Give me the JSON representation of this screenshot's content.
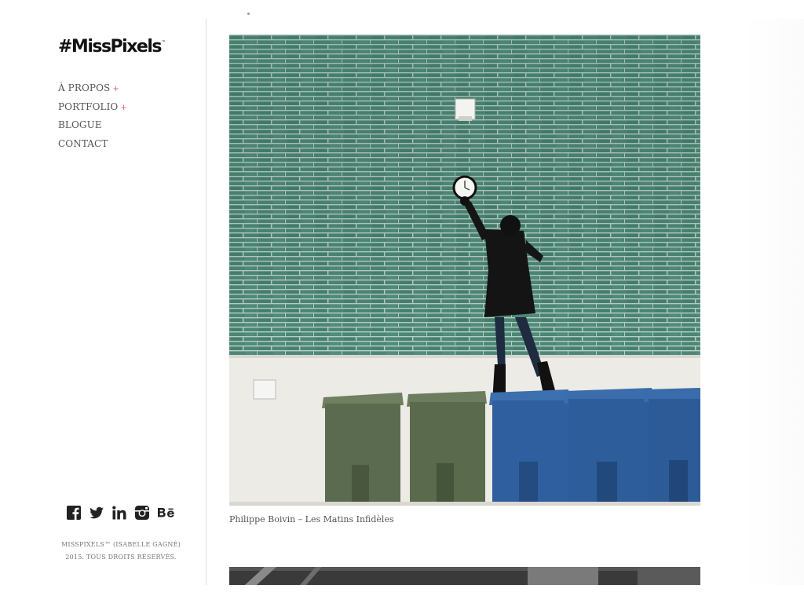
{
  "brand": {
    "logo_text": "#MissPixels",
    "logo_mark": "™"
  },
  "nav": {
    "items": [
      {
        "label": "À PROPOS",
        "suffix": "+"
      },
      {
        "label": "PORTFOLIO",
        "suffix": "+"
      },
      {
        "label": "BLOGUE",
        "suffix": ""
      },
      {
        "label": "CONTACT",
        "suffix": ""
      }
    ]
  },
  "social": [
    "facebook-icon",
    "twitter-icon",
    "linkedin-icon",
    "instagram-icon",
    "behance-icon"
  ],
  "footer": {
    "line1": "MISSPIXELS™ (ISABELLE GAGNÉ)",
    "line2": "2015. TOUS DROITS RÉSERVÉS."
  },
  "post": {
    "caption": "Philippe Boivin – Les Matins Infidèles"
  },
  "colors": {
    "accent": "#e85a74",
    "wall": "#4c8674",
    "bin_green": "#5a6b4e",
    "bin_blue": "#2f5f9e"
  }
}
